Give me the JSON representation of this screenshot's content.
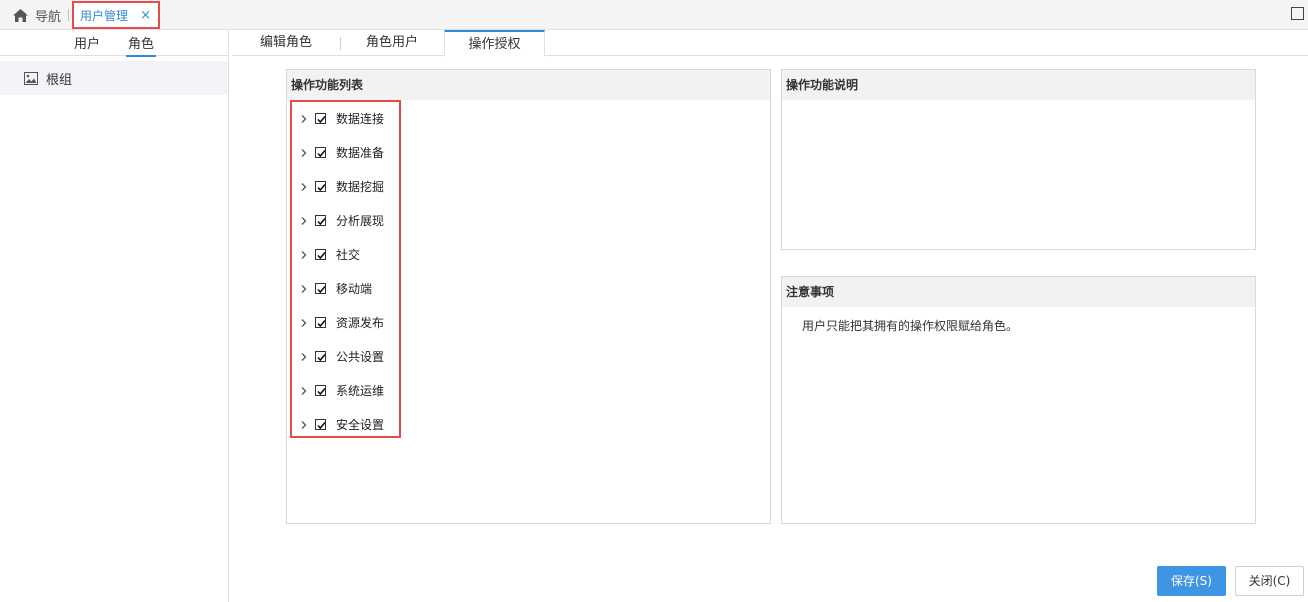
{
  "topbar": {
    "nav_label": "导航",
    "active_tab_label": "用户管理",
    "close_glyph": "×",
    "home_icon": "home-icon",
    "maximize_icon": "maximize-icon"
  },
  "sidebar": {
    "tabs": [
      {
        "label": "用户"
      },
      {
        "label": "角色"
      }
    ],
    "active_tab": "角色",
    "tree": [
      {
        "label": "根组",
        "icon": "image-icon"
      }
    ]
  },
  "content_tabs": [
    {
      "label": "编辑角色"
    },
    {
      "label": "角色用户"
    },
    {
      "label": "操作授权"
    }
  ],
  "active_content_tab": "操作授权",
  "function_panel": {
    "title": "操作功能列表",
    "items": [
      {
        "label": "数据连接",
        "checked": true
      },
      {
        "label": "数据准备",
        "checked": true
      },
      {
        "label": "数据挖掘",
        "checked": true
      },
      {
        "label": "分析展现",
        "checked": true
      },
      {
        "label": "社交",
        "checked": true
      },
      {
        "label": "移动端",
        "checked": true
      },
      {
        "label": "资源发布",
        "checked": true
      },
      {
        "label": "公共设置",
        "checked": true
      },
      {
        "label": "系统运维",
        "checked": true
      },
      {
        "label": "安全设置",
        "checked": true
      }
    ]
  },
  "description_panel": {
    "title": "操作功能说明"
  },
  "notes_panel": {
    "title": "注意事项",
    "text": "用户只能把其拥有的操作权限赋给角色。"
  },
  "buttons": {
    "save": "保存(S)",
    "close": "关闭(C)"
  },
  "colors": {
    "accent": "#2d8cdc",
    "primary_button": "#3d95e3",
    "highlight_border": "#e84a4a"
  }
}
